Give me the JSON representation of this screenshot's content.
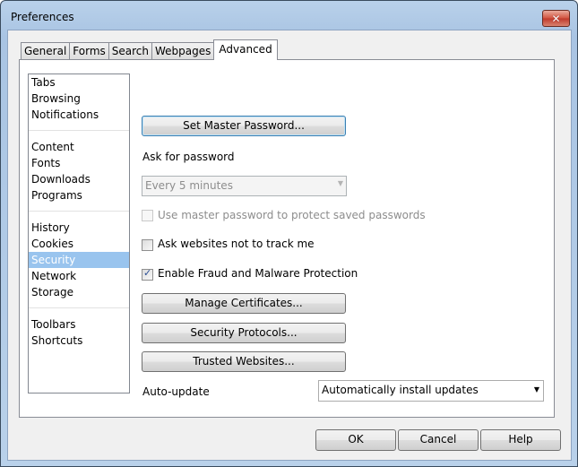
{
  "window": {
    "title": "Preferences",
    "close_icon": "close-icon"
  },
  "tabs": [
    {
      "label": "General",
      "active": false
    },
    {
      "label": "Forms",
      "active": false
    },
    {
      "label": "Search",
      "active": false
    },
    {
      "label": "Webpages",
      "active": false
    },
    {
      "label": "Advanced",
      "active": true
    }
  ],
  "sidebar": {
    "groups": [
      [
        "Tabs",
        "Browsing",
        "Notifications"
      ],
      [
        "Content",
        "Fonts",
        "Downloads",
        "Programs"
      ],
      [
        "History",
        "Cookies",
        "Security",
        "Network",
        "Storage"
      ],
      [
        "Toolbars",
        "Shortcuts"
      ]
    ],
    "selected": "Security"
  },
  "security": {
    "set_master_password_label": "Set Master Password...",
    "ask_for_password_label": "Ask for password",
    "ask_for_password_value": "Every 5 minutes",
    "use_master_password_label": "Use master password to protect saved passwords",
    "use_master_password_checked": false,
    "do_not_track_label": "Ask websites not to track me",
    "do_not_track_checked": false,
    "fraud_protection_label": "Enable Fraud and Malware Protection",
    "fraud_protection_checked": true,
    "manage_certificates_label": "Manage Certificates...",
    "security_protocols_label": "Security Protocols...",
    "trusted_websites_label": "Trusted Websites...",
    "auto_update_label": "Auto-update",
    "auto_update_value": "Automatically install updates"
  },
  "footer": {
    "ok_label": "OK",
    "cancel_label": "Cancel",
    "help_label": "Help"
  }
}
